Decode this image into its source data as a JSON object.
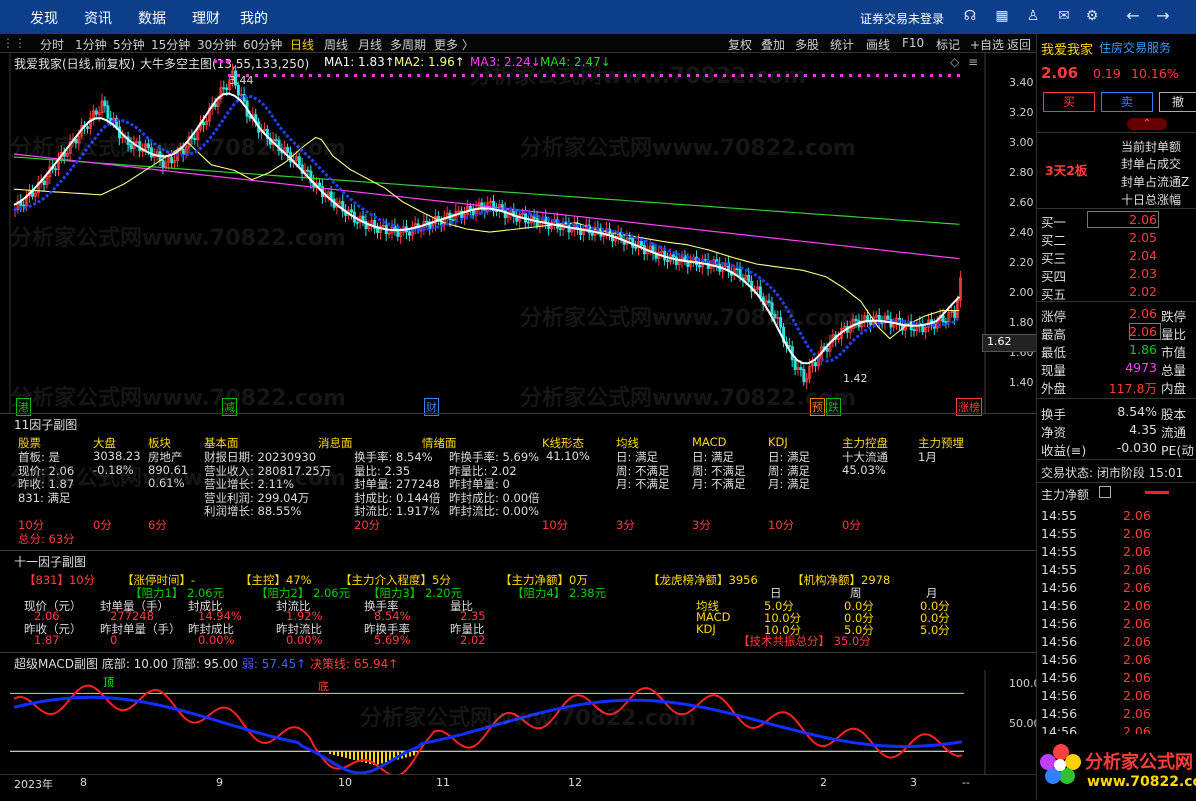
{
  "topnav": [
    "发现",
    "资讯",
    "数据",
    "理财",
    "我的"
  ],
  "login_text": "证券交易未登录",
  "toolbar_left": [
    "分时",
    "1分钟",
    "5分钟",
    "15分钟",
    "30分钟",
    "60分钟",
    "日线",
    "周线",
    "月线",
    "多周期",
    "更多 〉"
  ],
  "toolbar_right": [
    "复权",
    "叠加",
    "多股",
    "统计",
    "画线",
    "F10",
    "标记",
    "+自选",
    "返回"
  ],
  "chart_header": {
    "stock": "我爱我家(日线,前复权)",
    "indicator": "大牛多空主图(13,55,133,250)",
    "ma1": "MA1: 1.83↑",
    "ma2": "MA2: 1.96↑",
    "ma3": "MA3: 2.24↓",
    "ma4": "MA4: 2.47↓"
  },
  "price_axis": [
    "3.40",
    "3.20",
    "3.00",
    "2.80",
    "2.60",
    "2.40",
    "2.20",
    "2.00",
    "1.80",
    "1.60",
    "1.40"
  ],
  "price_marker": "1.62",
  "high_label": "3.44",
  "low_label": "1.42",
  "event_tags": [
    {
      "text": "港",
      "color": "#00c000"
    },
    {
      "text": "减",
      "color": "#00c000"
    },
    {
      "text": "财",
      "color": "#3080ff"
    },
    {
      "text": "预",
      "color": "#ff8000"
    },
    {
      "text": "跌",
      "color": "#00c000"
    },
    {
      "text": "涨榜",
      "color": "#ff3c3c"
    }
  ],
  "sub1": {
    "title": "11因子副图",
    "headers": [
      "股票",
      "大盘",
      "板块",
      "基本面",
      "消息面",
      "情绪面",
      "K线形态",
      "均线",
      "MACD",
      "KDJ",
      "主力控盘",
      "主力预埋"
    ],
    "stock_col": [
      "首板: 是",
      "现价: 2.06",
      "昨收: 1.87",
      "831: 满足"
    ],
    "market_col": [
      "3038.23",
      "-0.18%"
    ],
    "sector_col": [
      "房地产",
      "890.61",
      "0.61%"
    ],
    "fundamental_col": [
      "财报日期: 20230930",
      "营业收入: 280817.25万",
      "营业增长: 2.11%",
      "营业利润: 299.04万",
      "利润增长: 88.55%"
    ],
    "sentiment_a": [
      "换手率: 8.54%",
      "量比: 2.35",
      "封单量: 277248",
      "封成比: 0.144倍",
      "封流比: 1.917%"
    ],
    "sentiment_b": [
      "昨换手率: 5.69%",
      "昨量比: 2.02",
      "昨封单量: 0",
      "昨封成比: 0.00倍",
      "昨封流比: 0.00%"
    ],
    "kline": "41.10%",
    "ma_col": [
      "日: 满足",
      "周: 不满足",
      "月: 不满足"
    ],
    "macd_col": [
      "日: 满足",
      "周: 不满足",
      "月: 不满足"
    ],
    "kdj_col": [
      "日: 满足",
      "周: 满足",
      "月: 满足"
    ],
    "control_col": [
      "十大流通",
      "45.03%"
    ],
    "preburied": "1月",
    "scores": [
      "10分",
      "0分",
      "6分",
      "20分",
      "10分",
      "3分",
      "3分",
      "10分",
      "0分"
    ],
    "total": "总分: 63分"
  },
  "sub2": {
    "title": "十一因子副图",
    "row1": [
      "【831】10分",
      "【涨停时间】-",
      "【主控】47%",
      "【主力介入程度】5分",
      "【主力净额】0万",
      "【龙虎榜净额】3956",
      "【机构净额】2978"
    ],
    "row2": [
      "【阻力1】 2.06元",
      "【阻力2】 2.06元",
      "【阻力3】 2.20元",
      "【阻力4】 2.38元"
    ],
    "labels_a": [
      "现价（元）",
      "封单量（手）",
      "封成比",
      "封流比",
      "换手率",
      "量比"
    ],
    "values_a": [
      "2.06",
      "277248",
      "14.94%",
      "1.92%",
      "8.54%",
      "2.35"
    ],
    "labels_b": [
      "昨收（元）",
      "昨封单量（手）",
      "昨封成比",
      "昨封流比",
      "昨换手率",
      "昨量比"
    ],
    "values_b": [
      "1.87",
      "0",
      "0.00%",
      "0.00%",
      "5.69%",
      "2.02"
    ],
    "period_headers": [
      "日",
      "周",
      "月"
    ],
    "period_rows": [
      {
        "label": "均线",
        "vals": [
          "5.0分",
          "0.0分",
          "0.0分"
        ]
      },
      {
        "label": "MACD",
        "vals": [
          "10.0分",
          "0.0分",
          "0.0分"
        ]
      },
      {
        "label": "KDJ",
        "vals": [
          "10.0分",
          "5.0分",
          "5.0分"
        ]
      }
    ],
    "tech_total": "【技术共振总分】 35.0分"
  },
  "sub3": {
    "title": "超级MACD副图",
    "bottom": "底部: 10.00",
    "top": "顶部: 95.00",
    "short": "弱: 57.45↑",
    "decision": "决策线: 65.94↑",
    "axis": [
      "100.0",
      "50.00"
    ],
    "top_tag": "顶",
    "bottom_tag": "底"
  },
  "date_axis": [
    "2023年",
    "8",
    "9",
    "10",
    "11",
    "12",
    "2",
    "3",
    "--"
  ],
  "right": {
    "name": "我爱我家",
    "industry": "住房交易服务",
    "price": "2.06",
    "change": "0.19",
    "pct": "10.16%",
    "buy": "买",
    "sell": "卖",
    "more": "撤",
    "board_tag": "3天2板",
    "board_info": [
      "当前封单额",
      "封单占成交",
      "封单占流通Z",
      "十日总涨幅"
    ],
    "bids": [
      {
        "label": "买一",
        "price": "2.06"
      },
      {
        "label": "买二",
        "price": "2.05"
      },
      {
        "label": "买三",
        "price": "2.04"
      },
      {
        "label": "买四",
        "price": "2.03"
      },
      {
        "label": "买五",
        "price": "2.02"
      }
    ],
    "stats": [
      {
        "l": "涨停",
        "v": "2.06",
        "v2": "跌停",
        "c": "#ff3c3c"
      },
      {
        "l": "最高",
        "v": "2.06",
        "v2": "量比",
        "c": "#ff3c3c"
      },
      {
        "l": "最低",
        "v": "1.86",
        "v2": "市值",
        "c": "#00d000"
      },
      {
        "l": "现量",
        "v": "4973",
        "v2": "总量",
        "c": "#ff40ff"
      },
      {
        "l": "外盘",
        "v": "117.8万",
        "v2": "内盘",
        "c": "#ff3c3c"
      }
    ],
    "stats2": [
      {
        "l": "换手",
        "v": "8.54%",
        "v2": "股本"
      },
      {
        "l": "净资",
        "v": "4.35",
        "v2": "流通"
      },
      {
        "l": "收益(≡)",
        "v": "-0.030",
        "v2": "PE(动"
      }
    ],
    "status": "交易状态: 闭市阶段 15:01",
    "netflow": "主力净额",
    "trades": [
      {
        "t": "14:55",
        "p": "2.06"
      },
      {
        "t": "14:55",
        "p": "2.06"
      },
      {
        "t": "14:55",
        "p": "2.06"
      },
      {
        "t": "14:55",
        "p": "2.06"
      },
      {
        "t": "14:56",
        "p": "2.06"
      },
      {
        "t": "14:56",
        "p": "2.06"
      },
      {
        "t": "14:56",
        "p": "2.06"
      },
      {
        "t": "14:56",
        "p": "2.06"
      },
      {
        "t": "14:56",
        "p": "2.06"
      },
      {
        "t": "14:56",
        "p": "2.06"
      },
      {
        "t": "14:56",
        "p": "2.06"
      },
      {
        "t": "14:56",
        "p": "2.06"
      },
      {
        "t": "14:56",
        "p": "2.06"
      }
    ]
  },
  "logo_text": "分析家公式网",
  "logo_url": "www.70822.com",
  "watermark": "分析家公式网www.70822.com",
  "colors": {
    "up": "#ff3c3c",
    "down": "#30e0e0",
    "ma1": "#ffffff",
    "ma2": "#ffff80",
    "ma3": "#ff40ff",
    "ma4": "#30d030",
    "macd_red": "#ff2020",
    "macd_blue": "#1030ff"
  }
}
